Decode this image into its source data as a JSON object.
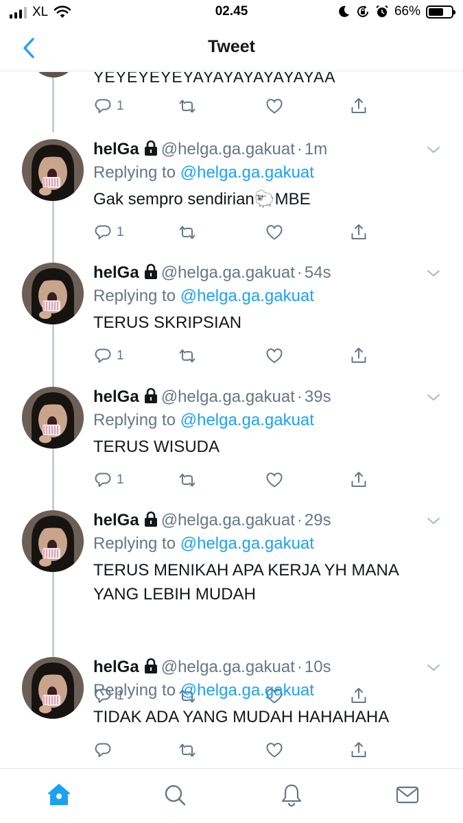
{
  "status_bar": {
    "carrier": "XL",
    "time": "02.45",
    "battery_percent": "66%",
    "battery_level": 0.66,
    "icons": [
      "signal-icon",
      "wifi-icon",
      "moon-icon",
      "rotation-lock-icon",
      "alarm-icon",
      "battery-icon"
    ]
  },
  "header": {
    "title": "Tweet",
    "back_icon": "chevron-left-icon"
  },
  "colors": {
    "accent": "#1da1f2",
    "secondary_text": "#657786",
    "primary_text": "#14171a",
    "thread_line": "#c4cfd6"
  },
  "top_partial_tweet": {
    "text": "YEYEYEYEYAYAYAYAYAYAYAA",
    "reply_count": "1"
  },
  "tweets": [
    {
      "name": "helGa",
      "handle": "@helga.ga.gakuat",
      "time": "1m",
      "replying_prefix": "Replying to",
      "replying_to": "@helga.ga.gakuat",
      "text": "Gak sempro sendirian🐑MBE",
      "reply_count": "1"
    },
    {
      "name": "helGa",
      "handle": "@helga.ga.gakuat",
      "time": "54s",
      "replying_prefix": "Replying to",
      "replying_to": "@helga.ga.gakuat",
      "text": "TERUS SKRIPSIAN",
      "reply_count": "1"
    },
    {
      "name": "helGa",
      "handle": "@helga.ga.gakuat",
      "time": "39s",
      "replying_prefix": "Replying to",
      "replying_to": "@helga.ga.gakuat",
      "text": "TERUS WISUDA",
      "reply_count": "1"
    },
    {
      "name": "helGa",
      "handle": "@helga.ga.gakuat",
      "time": "29s",
      "replying_prefix": "Replying to",
      "replying_to": "@helga.ga.gakuat",
      "text": "TERUS MENIKAH APA KERJA YH MANA YANG LEBIH MUDAH",
      "reply_count": "1"
    },
    {
      "name": "helGa",
      "handle": "@helga.ga.gakuat",
      "time": "10s",
      "replying_prefix": "Replying to",
      "replying_to": "@helga.ga.gakuat",
      "text": "TIDAK ADA YANG MUDAH HAHAHAHA",
      "reply_count": ""
    }
  ],
  "tab_bar": {
    "items": [
      "home-icon",
      "search-icon",
      "notifications-icon",
      "messages-icon"
    ],
    "active": "home-icon"
  }
}
